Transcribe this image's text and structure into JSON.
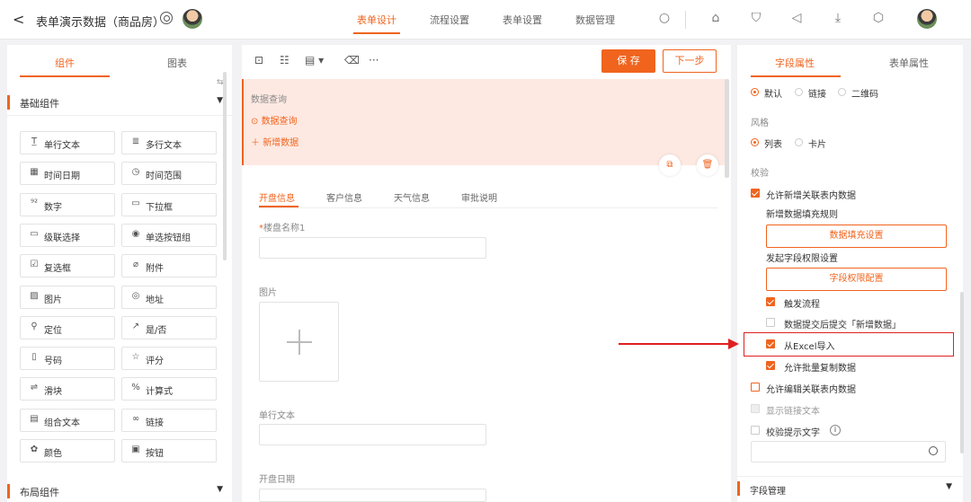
{
  "topbar": {
    "back": "<",
    "title": "表单演示数据（商品房）",
    "tabs": [
      "表单设计",
      "流程设置",
      "表单设置",
      "数据管理"
    ]
  },
  "left": {
    "tabs": [
      "组件",
      "图表"
    ],
    "group_basic": "基础组件",
    "components": [
      {
        "icon": "T̲",
        "label": "单行文本"
      },
      {
        "icon": "≣",
        "label": "多行文本"
      },
      {
        "icon": "▦",
        "label": "时间日期"
      },
      {
        "icon": "◷",
        "label": "时间范围"
      },
      {
        "icon": "⁹²",
        "label": "数字"
      },
      {
        "icon": "▭",
        "label": "下拉框"
      },
      {
        "icon": "▭",
        "label": "级联选择"
      },
      {
        "icon": "◉",
        "label": "单选按钮组"
      },
      {
        "icon": "☑",
        "label": "复选框"
      },
      {
        "icon": "⌀",
        "label": "附件"
      },
      {
        "icon": "▨",
        "label": "图片"
      },
      {
        "icon": "◎",
        "label": "地址"
      },
      {
        "icon": "⚲",
        "label": "定位"
      },
      {
        "icon": "↗",
        "label": "是/否"
      },
      {
        "icon": "▯",
        "label": "号码"
      },
      {
        "icon": "☆",
        "label": "评分"
      },
      {
        "icon": "⇌",
        "label": "滑块"
      },
      {
        "icon": "%",
        "label": "计算式"
      },
      {
        "icon": "▤",
        "label": "组合文本"
      },
      {
        "icon": "∞",
        "label": "链接"
      },
      {
        "icon": "✿",
        "label": "颜色"
      },
      {
        "icon": "▣",
        "label": "按钮"
      }
    ],
    "group_layout": "布局组件"
  },
  "center": {
    "toolbar_more": "···",
    "save": "保 存",
    "next": "下一步",
    "query_title": "数据查询",
    "query_link": "数据查询",
    "add_link": "新增数据",
    "form_tabs": [
      "开盘信息",
      "客户信息",
      "天气信息",
      "审批说明"
    ],
    "field_name_label": "楼盘名称1",
    "field_image_label": "图片",
    "field_text_label": "单行文本",
    "field_date_label": "开盘日期"
  },
  "right": {
    "tabs": [
      "字段属性",
      "表单属性"
    ],
    "display_opts": [
      "默认",
      "链接",
      "二维码"
    ],
    "style_label": "风格",
    "style_opts": [
      "列表",
      "卡片"
    ],
    "validate_label": "校验",
    "allow_add": "允许新增关联表内数据",
    "fill_rule_label": "新增数据填充规则",
    "fill_btn": "数据填充设置",
    "perm_label": "发起字段权限设置",
    "perm_btn": "字段权限配置",
    "trigger_flow": "触发流程",
    "submit_after": "数据提交后提交「新增数据」",
    "from_excel": "从Excel导入",
    "allow_batch": "允许批量复制数据",
    "allow_edit": "允许编辑关联表内数据",
    "show_link": "显示链接文本",
    "validate_tip": "校验提示文字",
    "tip_icon": "i",
    "field_manage": "字段管理"
  }
}
